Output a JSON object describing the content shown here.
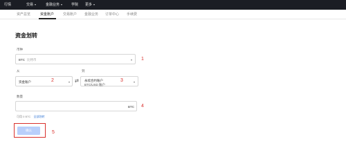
{
  "topnav": {
    "items": [
      {
        "label": "行情",
        "dropdown": false
      },
      {
        "label": "交易",
        "dropdown": true
      },
      {
        "label": "金融业务",
        "dropdown": true
      },
      {
        "label": "学院",
        "dropdown": false
      },
      {
        "label": "更多",
        "dropdown": true
      }
    ]
  },
  "subnav": {
    "tabs": [
      {
        "label": "资产总览",
        "active": false
      },
      {
        "label": "资金账户",
        "active": true
      },
      {
        "label": "交易账户",
        "active": false
      },
      {
        "label": "金融业务",
        "active": false
      },
      {
        "label": "订单中心",
        "active": false
      },
      {
        "label": "手续费",
        "active": false
      }
    ]
  },
  "page": {
    "title": "资金划转"
  },
  "form": {
    "currency": {
      "label": "币种",
      "value": "BTC",
      "hint": "比特币"
    },
    "from": {
      "label": "从",
      "value": "资金账户"
    },
    "to": {
      "label": "到",
      "line1": "永续合约账户",
      "line2": "BTC/USD 账户"
    },
    "amount": {
      "label": "数量",
      "unit": "BTC"
    },
    "available": {
      "text": "可用 0 BTC",
      "link": "全部划转"
    },
    "confirm_label": "确认"
  },
  "annotations": {
    "n1": "1",
    "n2": "2",
    "n3": "3",
    "n4": "4",
    "n5": "5"
  },
  "colors": {
    "topbar": "#1b1d24",
    "accent": "#3a7bd5",
    "annotation": "#d9302c",
    "button": "#b9cffb"
  }
}
